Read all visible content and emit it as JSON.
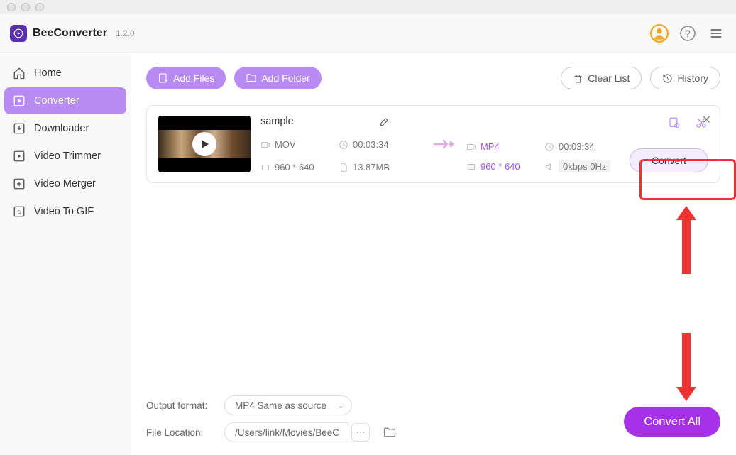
{
  "app": {
    "name": "BeeConverter",
    "version": "1.2.0"
  },
  "sidebar": {
    "items": [
      {
        "label": "Home"
      },
      {
        "label": "Converter"
      },
      {
        "label": "Downloader"
      },
      {
        "label": "Video Trimmer"
      },
      {
        "label": "Video Merger"
      },
      {
        "label": "Video To GIF"
      }
    ]
  },
  "toolbar": {
    "add_files": "Add Files",
    "add_folder": "Add Folder",
    "clear_list": "Clear List",
    "history": "History"
  },
  "item": {
    "name": "sample",
    "src": {
      "format": "MOV",
      "duration": "00:03:34",
      "resolution": "960 * 640",
      "size": "13.87MB"
    },
    "dst": {
      "format": "MP4",
      "duration": "00:03:34",
      "resolution": "960 * 640",
      "audio": "0kbps 0Hz"
    },
    "convert_label": "Convert"
  },
  "footer": {
    "format_label": "Output format:",
    "format_value": "MP4 Same as source",
    "location_label": "File Location:",
    "location_value": "/Users/link/Movies/BeeC"
  },
  "convert_all": "Convert All"
}
